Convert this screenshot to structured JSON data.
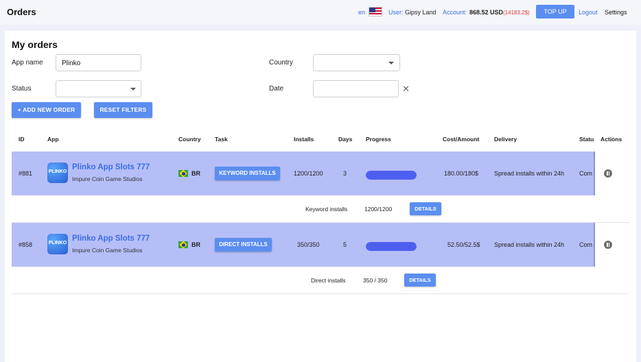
{
  "header": {
    "title": "Orders",
    "lang": "en",
    "user_label": "User:",
    "user_name": "Gipsy Land",
    "account_label": "Account:",
    "account_value": "868.52 USD",
    "account_negative": "(14183.2$)",
    "topup_label": "TOP UP",
    "logout_label": "Logout",
    "settings_label": "Settings"
  },
  "page": {
    "title": "My orders"
  },
  "filters": {
    "app_name_label": "App name",
    "app_name_value": "Plinko",
    "country_label": "Country",
    "country_value": "",
    "status_label": "Status",
    "status_value": "",
    "date_label": "Date",
    "date_value": "",
    "clear_glyph": "✕",
    "add_order_label": "+ ADD NEW ORDER",
    "reset_label": "RESET FILTERS"
  },
  "table": {
    "headers": [
      "ID",
      "App",
      "Country",
      "Task",
      "Installs",
      "Days",
      "Progress",
      "Cost/Amount",
      "Delivery",
      "Statu",
      "Actions"
    ],
    "rows": [
      {
        "id": "#881",
        "icon_text": "PLINKO",
        "app_name": "Plinko App Slots 777",
        "developer": "Impure Coin Game Studios",
        "country": "BR",
        "task": "KEYWORD INSTALLS",
        "installs": "1200/1200",
        "days": "3",
        "progress": 1.0,
        "cost": "180.00/180$",
        "delivery": "Spread installs within 24h",
        "status": "Com",
        "sub": {
          "task": "Keyword installs",
          "value": "1200/1200",
          "button": "DETAILS"
        }
      },
      {
        "id": "#858",
        "icon_text": "PLINKO",
        "app_name": "Plinko App Slots 777",
        "developer": "Impure Coin Game Studios",
        "country": "BR",
        "task": "DIRECT INSTALLS",
        "installs": "350/350",
        "days": "5",
        "progress": 1.0,
        "cost": "52.50/52.5$",
        "delivery": "Spread installs within 24h",
        "status": "Com",
        "sub": {
          "task": "Direct installs",
          "value": "350 / 350",
          "button": "DETAILS"
        }
      }
    ]
  },
  "colors": {
    "accent": "#5b8ef0",
    "row_highlight": "#b6bef7",
    "progress": "#4e5ff0",
    "negative": "#e53935"
  },
  "icons": {
    "pause": "pause-icon",
    "select": "chevron-down-icon",
    "clear": "close-icon",
    "flag_us": "us-flag-icon",
    "flag_br": "br-flag-icon"
  }
}
